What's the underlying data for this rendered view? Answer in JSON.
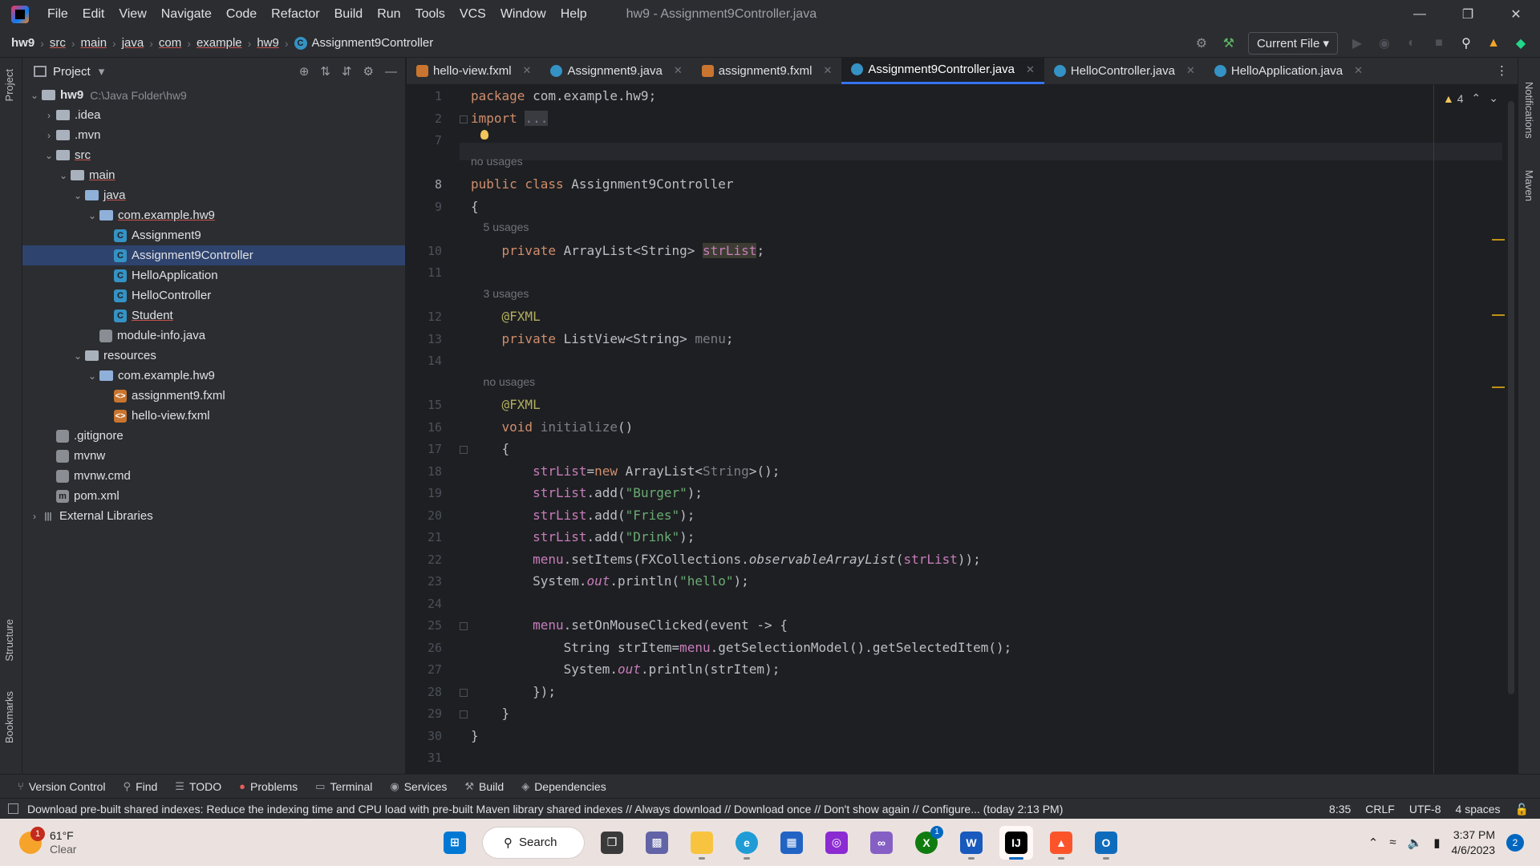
{
  "menu": [
    "File",
    "Edit",
    "View",
    "Navigate",
    "Code",
    "Refactor",
    "Build",
    "Run",
    "Tools",
    "VCS",
    "Window",
    "Help"
  ],
  "window_title": "hw9 - Assignment9Controller.java",
  "breadcrumb": [
    "hw9",
    "src",
    "main",
    "java",
    "com",
    "example",
    "hw9",
    "Assignment9Controller"
  ],
  "run_config": "Current File",
  "project_panel": {
    "title": "Project",
    "tree": [
      {
        "label": "hw9",
        "extra": "C:\\Java Folder\\hw9",
        "icon": "folder-icon",
        "arrow": "⌄",
        "depth": 0,
        "bold": true
      },
      {
        "label": ".idea",
        "icon": "folder-icon",
        "arrow": "›",
        "depth": 1
      },
      {
        "label": ".mvn",
        "icon": "folder-icon",
        "arrow": "›",
        "depth": 1
      },
      {
        "label": "src",
        "icon": "folder-icon",
        "arrow": "⌄",
        "depth": 1,
        "underline": true
      },
      {
        "label": "main",
        "icon": "folder-icon",
        "arrow": "⌄",
        "depth": 2,
        "underline": true
      },
      {
        "label": "java",
        "icon": "source-folder-icon",
        "arrow": "⌄",
        "depth": 3,
        "underline": true
      },
      {
        "label": "com.example.hw9",
        "icon": "package-icon",
        "arrow": "⌄",
        "depth": 4,
        "underline": true
      },
      {
        "label": "Assignment9",
        "icon": "class-icon",
        "depth": 5
      },
      {
        "label": "Assignment9Controller",
        "icon": "class-icon",
        "depth": 5,
        "selected": true
      },
      {
        "label": "HelloApplication",
        "icon": "class-icon",
        "depth": 5
      },
      {
        "label": "HelloController",
        "icon": "class-icon",
        "depth": 5
      },
      {
        "label": "Student",
        "icon": "class-icon",
        "depth": 5,
        "underline": true
      },
      {
        "label": "module-info.java",
        "icon": "java-file-icon",
        "depth": 4
      },
      {
        "label": "resources",
        "icon": "resources-folder-icon",
        "arrow": "⌄",
        "depth": 3
      },
      {
        "label": "com.example.hw9",
        "icon": "package-icon",
        "arrow": "⌄",
        "depth": 4
      },
      {
        "label": "assignment9.fxml",
        "icon": "fxml-file-icon",
        "depth": 5
      },
      {
        "label": "hello-view.fxml",
        "icon": "fxml-file-icon",
        "depth": 5
      },
      {
        "label": ".gitignore",
        "icon": "text-file-icon",
        "depth": 1
      },
      {
        "label": "mvnw",
        "icon": "script-file-icon",
        "depth": 1
      },
      {
        "label": "mvnw.cmd",
        "icon": "text-file-icon",
        "depth": 1
      },
      {
        "label": "pom.xml",
        "icon": "maven-file-icon",
        "depth": 1
      },
      {
        "label": "External Libraries",
        "icon": "library-icon",
        "arrow": "›",
        "depth": 0
      }
    ]
  },
  "tabs": [
    {
      "label": "hello-view.fxml",
      "icon": "fxml-file-icon"
    },
    {
      "label": "Assignment9.java",
      "icon": "class-icon"
    },
    {
      "label": "assignment9.fxml",
      "icon": "fxml-file-icon"
    },
    {
      "label": "Assignment9Controller.java",
      "icon": "class-icon",
      "active": true
    },
    {
      "label": "HelloController.java",
      "icon": "class-icon"
    },
    {
      "label": "HelloApplication.java",
      "icon": "class-icon"
    }
  ],
  "editor": {
    "warning_count": "4",
    "current_line": "8",
    "lines": [
      {
        "n": "1",
        "html": "<span class='kw'>package</span> com.example.hw9;"
      },
      {
        "n": "2",
        "html": "<span class='kw'>import</span> <span class='gray' style='background:#393b40'>...</span>"
      },
      {
        "n": "7",
        "html": ""
      },
      {
        "hint": "no usages"
      },
      {
        "n": "8",
        "html": "<span class='kw'>public class</span> Assignment9Controller"
      },
      {
        "n": "9",
        "html": "{"
      },
      {
        "hint": "    5 usages"
      },
      {
        "n": "10",
        "html": "    <span class='kw'>private</span> ArrayList&lt;String&gt; <span class='fld hl'>strList</span>;"
      },
      {
        "n": "11",
        "html": ""
      },
      {
        "hint": "    3 usages"
      },
      {
        "n": "12",
        "html": "    <span class='ann'>@FXML</span>"
      },
      {
        "n": "13",
        "html": "    <span class='kw'>private</span> ListView&lt;String&gt; <span class='gray'>menu</span>;"
      },
      {
        "n": "14",
        "html": ""
      },
      {
        "hint": "    no usages"
      },
      {
        "n": "15",
        "html": "    <span class='ann'>@FXML</span>"
      },
      {
        "n": "16",
        "html": "    <span class='kw'>void</span> <span class='gray'>initialize</span>()"
      },
      {
        "n": "17",
        "html": "    {"
      },
      {
        "n": "18",
        "html": "        <span class='fld'>strList</span>=<span class='kw'>new</span> ArrayList&lt;<span class='gray'>String</span>&gt;();"
      },
      {
        "n": "19",
        "html": "        <span class='fld'>strList</span>.add(<span class='str'>\"Burger\"</span>);"
      },
      {
        "n": "20",
        "html": "        <span class='fld'>strList</span>.add(<span class='str'>\"Fries\"</span>);"
      },
      {
        "n": "21",
        "html": "        <span class='fld'>strList</span>.add(<span class='str'>\"Drink\"</span>);"
      },
      {
        "n": "22",
        "html": "        <span class='fld'>menu</span>.setItems(FXCollections.<span class='ital'>observableArrayList</span>(<span class='fld'>strList</span>));"
      },
      {
        "n": "23",
        "html": "        System.<span class='fld ital'>out</span>.println(<span class='str'>\"hello\"</span>);"
      },
      {
        "n": "24",
        "html": ""
      },
      {
        "n": "25",
        "html": "        <span class='fld'>menu</span>.setOnMouseClicked(event -&gt; {"
      },
      {
        "n": "26",
        "html": "            String strItem=<span class='fld'>menu</span>.getSelectionModel().getSelectedItem();"
      },
      {
        "n": "27",
        "html": "            System.<span class='fld ital'>out</span>.println(strItem);"
      },
      {
        "n": "28",
        "html": "        });"
      },
      {
        "n": "29",
        "html": "    }"
      },
      {
        "n": "30",
        "html": "}"
      },
      {
        "n": "31",
        "html": ""
      }
    ]
  },
  "left_stripe": [
    "Project",
    "Structure",
    "Bookmarks"
  ],
  "right_stripe": [
    "Notifications",
    "Maven"
  ],
  "bottom_tools": [
    {
      "label": "Version Control",
      "icon": "branch-icon"
    },
    {
      "label": "Find",
      "icon": "search-icon"
    },
    {
      "label": "TODO",
      "icon": "list-icon"
    },
    {
      "label": "Problems",
      "icon": "error-icon"
    },
    {
      "label": "Terminal",
      "icon": "terminal-icon"
    },
    {
      "label": "Services",
      "icon": "services-icon"
    },
    {
      "label": "Build",
      "icon": "hammer-icon"
    },
    {
      "label": "Dependencies",
      "icon": "layers-icon"
    }
  ],
  "status": {
    "message": "Download pre-built shared indexes: Reduce the indexing time and CPU load with pre-built Maven library shared indexes // Always download // Download once // Don't show again // Configure... (today 2:13 PM)",
    "position": "8:35",
    "line_sep": "CRLF",
    "encoding": "UTF-8",
    "indent": "4 spaces"
  },
  "taskbar": {
    "temperature": "61°F",
    "condition": "Clear",
    "weather_badge": "1",
    "search_label": "Search",
    "time": "3:37 PM",
    "date": "4/6/2023",
    "notif_count": "2",
    "xbox_badge": "1"
  }
}
